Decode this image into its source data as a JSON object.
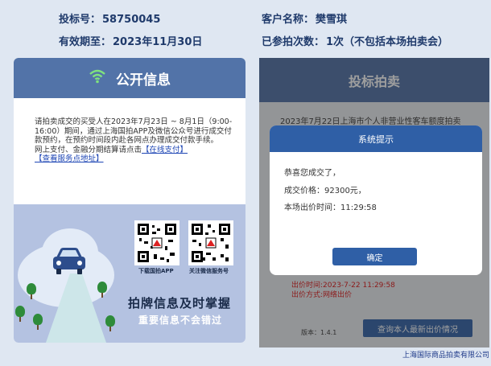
{
  "header": {
    "bid_no_label": "投标号：",
    "bid_no_value": "58750045",
    "valid_label": "有效期至：",
    "valid_value": "2023年11月30日",
    "client_label": "客户名称：",
    "client_value": "樊雪琪",
    "attended_label": "已参拍次数：",
    "attended_value": "1次（不包括本场拍卖会）"
  },
  "left_panel": {
    "title": "公开信息",
    "notice_text": "请拍卖成交的买受人在2023年7月23日 ~ 8月1日（9:00-16:00）期间，通过上海国拍APP及微信公众号进行成交付款预约，在预约时间段内赴各网点办理成交付款手续。",
    "notice_text2": "网上支付、金融分期结算请点击",
    "link_online_pay": "【在线支付】",
    "link_service_points": "【查看服务点地址】",
    "qr1_label": "下载国拍APP",
    "qr2_label": "关注微信服务号",
    "slogan_main": "拍牌信息及时掌握",
    "slogan_sub": "重要信息不会错过"
  },
  "right_panel": {
    "title": "投标拍卖",
    "background_line": "2023年7月22日上海市个人非营业性客车额度拍卖",
    "bid_time": "出价时间:2023-7-22 11:29:58",
    "bid_method": "出价方式:网络出价",
    "version": "版本：1.4.1",
    "query_button": "查询本人最新出价情况"
  },
  "dialog": {
    "title": "系统提示",
    "line1": "恭喜您成交了，",
    "line2": "成交价格：92300元，",
    "line3": "本场出价时间：11:29:58",
    "ok_button": "确定"
  },
  "footer": {
    "company": "上海国际商品拍卖有限公司"
  },
  "colors": {
    "header_text": "#1f3a6b",
    "panel_header": "#5273a8",
    "primary_button": "#2f5fa6",
    "link": "#1f47b5",
    "warning_red": "#dd1111"
  }
}
